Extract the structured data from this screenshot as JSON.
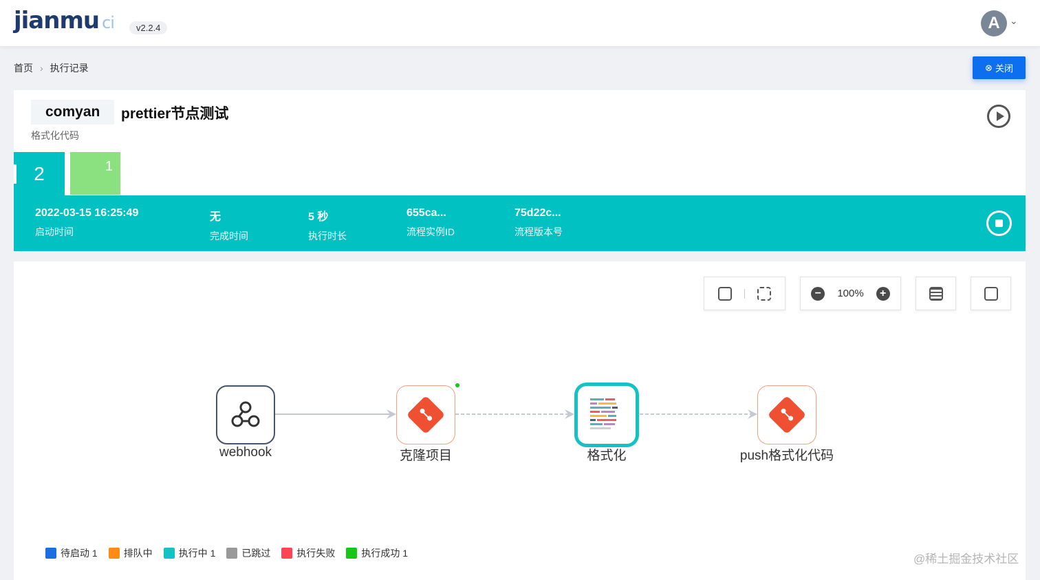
{
  "header": {
    "logo_text": "jianmu",
    "logo_ci": "ci",
    "version": "v2.2.4",
    "avatar_initial": "A"
  },
  "breadcrumb": {
    "home": "首页",
    "current": "执行记录"
  },
  "close_button": {
    "label": "关闭"
  },
  "workflow": {
    "owner": "comyan",
    "name": "prettier节点测试",
    "description": "格式化代码"
  },
  "record_tabs": [
    {
      "label": "2",
      "color": "#01c1c2"
    },
    {
      "label": "1",
      "color": "#8be07f"
    }
  ],
  "run_info": {
    "start_time": {
      "value": "2022-03-15 16:25:49",
      "label": "启动时间"
    },
    "end_time": {
      "value": "无",
      "label": "完成时间"
    },
    "duration": {
      "value": "5 秒",
      "label": "执行时长"
    },
    "instance_id": {
      "value": "655ca...",
      "label": "流程实例ID"
    },
    "version_no": {
      "value": "75d22c...",
      "label": "流程版本号"
    }
  },
  "toolbar": {
    "zoom": "100%"
  },
  "nodes": [
    {
      "label": "webhook",
      "icon": "webhook-icon"
    },
    {
      "label": "克隆项目",
      "icon": "git-icon"
    },
    {
      "label": "格式化",
      "icon": "prettier-icon"
    },
    {
      "label": "push格式化代码",
      "icon": "git-icon"
    }
  ],
  "legend": [
    {
      "label": "待启动 1",
      "color": "#1b6fe0"
    },
    {
      "label": "排队中",
      "color": "#ff8a14"
    },
    {
      "label": "执行中 1",
      "color": "#14c2c3"
    },
    {
      "label": "已跳过",
      "color": "#999999"
    },
    {
      "label": "执行失败",
      "color": "#ff4553"
    },
    {
      "label": "执行成功 1",
      "color": "#17c617"
    }
  ],
  "watermark": "@稀土掘金技术社区"
}
